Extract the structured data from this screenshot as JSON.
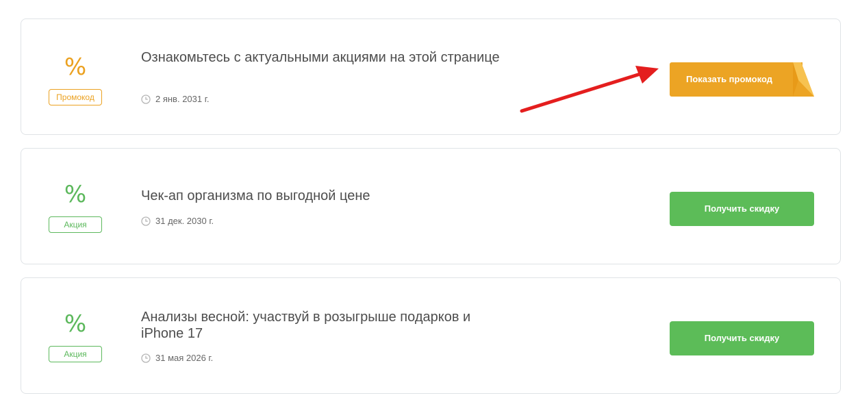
{
  "deals": [
    {
      "icon": "percent-icon",
      "percent_symbol": "%",
      "badge": "Промокод",
      "title": "Ознакомьтесь с актуальными акциями на этой странице",
      "date": "2 янв. 2031 г.",
      "button": "Показать промокод",
      "color": "#eba120",
      "button_color": "#eca424"
    },
    {
      "icon": "percent-icon",
      "percent_symbol": "%",
      "badge": "Акция",
      "title": "Чек-ап организма по выгодной цене",
      "date": "31 дек. 2030 г.",
      "button": "Получить скидку",
      "color": "#5cb85c",
      "button_color": "#5cbc58"
    },
    {
      "icon": "percent-icon",
      "percent_symbol": "%",
      "badge": "Акция",
      "title": "Анализы весной: участвуй в розыгрыше подарков и iPhone 17",
      "date": "31 мая 2026 г.",
      "button": "Получить скидку",
      "color": "#5cb85c",
      "button_color": "#5cbc58"
    }
  ],
  "annotation": {
    "type": "red-arrow",
    "color": "#e41e1e",
    "points_to": "Показать промокод"
  }
}
